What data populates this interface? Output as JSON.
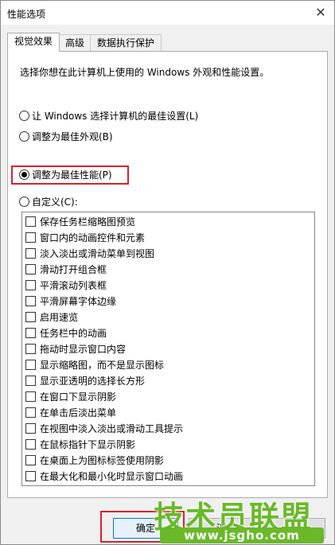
{
  "window": {
    "title": "性能选项",
    "close_glyph": "✕"
  },
  "tabs": [
    {
      "label": "视觉效果",
      "active": true
    },
    {
      "label": "高级",
      "active": false
    },
    {
      "label": "数据执行保护",
      "active": false
    }
  ],
  "panel": {
    "description": "选择你想在此计算机上使用的 Windows 外观和性能设置。",
    "radios": [
      {
        "label": "让 Windows 选择计算机的最佳设置(L)",
        "checked": false
      },
      {
        "label": "调整为最佳外观(B)",
        "checked": false
      },
      {
        "label": "调整为最佳性能(P)",
        "checked": true
      },
      {
        "label": "自定义(C):",
        "checked": false
      }
    ],
    "options": [
      "保存任务栏缩略图预览",
      "窗口内的动画控件和元素",
      "淡入淡出或滑动菜单到视图",
      "滑动打开组合框",
      "平滑滚动列表框",
      "平滑屏幕字体边缘",
      "启用速览",
      "任务栏中的动画",
      "拖动时显示窗口内容",
      "显示缩略图，而不是显示图标",
      "显示亚透明的选择长方形",
      "在窗口下显示阴影",
      "在单击后淡出菜单",
      "在视图中淡入淡出或滑动工具提示",
      "在鼠标指针下显示阴影",
      "在桌面上为图标标签使用阴影",
      "在最大化和最小化时显示窗口动画"
    ]
  },
  "buttons": {
    "ok": "确定",
    "cancel_partial": "消"
  },
  "watermark": {
    "brand": "技术员联盟",
    "url": "www.jsgho.com"
  },
  "colors": {
    "highlight": "#d6232b",
    "watermark_green": "#6ab929",
    "accent": "#0078d7"
  }
}
